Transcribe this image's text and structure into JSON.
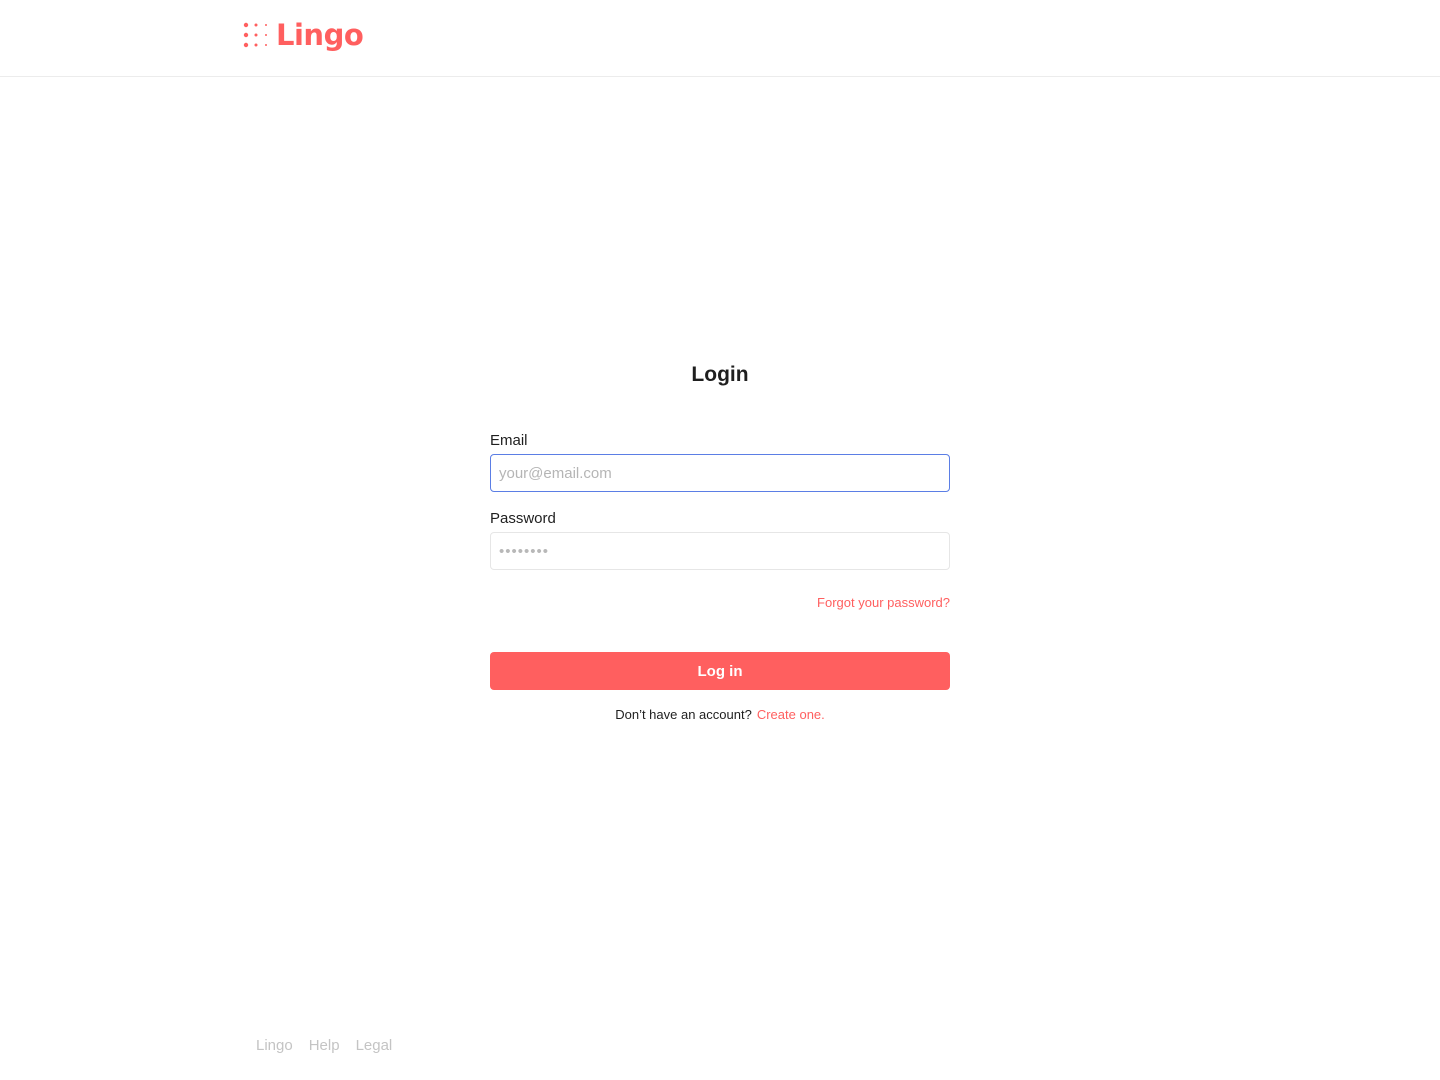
{
  "header": {
    "logo_text": "Lingo",
    "logo_icon": "dot-grid-icon",
    "brand_color": "#ff5f5f"
  },
  "login": {
    "title": "Login",
    "email_label": "Email",
    "email_placeholder": "your@email.com",
    "email_value": "",
    "password_label": "Password",
    "password_placeholder": "••••••••",
    "password_value": "",
    "forgot_link": "Forgot your password?",
    "submit_label": "Log in",
    "signup_prompt": "Don’t have an account?",
    "signup_link": "Create one."
  },
  "footer": {
    "links": [
      "Lingo",
      "Help",
      "Legal"
    ]
  },
  "colors": {
    "accent": "#ff5f5f",
    "focus_border": "#5b7ee5"
  }
}
